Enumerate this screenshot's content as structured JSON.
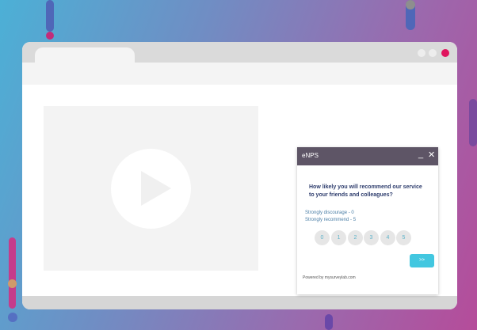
{
  "colors": {
    "widget_header": "#5e5566",
    "next_button": "#42c7e0",
    "question_text": "#2e3d6d",
    "window_close": "#e0145e"
  },
  "widget": {
    "title": "eNPS",
    "minimize_icon": "minimize-icon",
    "close_icon": "close-icon",
    "question": "How likely you will recommend our service to your friends and colleagues?",
    "scale_low": "Strongly discourage - 0",
    "scale_high": "Strongly recommend - 5",
    "scores": [
      "0",
      "1",
      "2",
      "3",
      "4",
      "5"
    ],
    "next_label": ">>",
    "powered_by": "Powered by mysurveylab.com"
  },
  "video": {
    "icon": "play-icon"
  }
}
